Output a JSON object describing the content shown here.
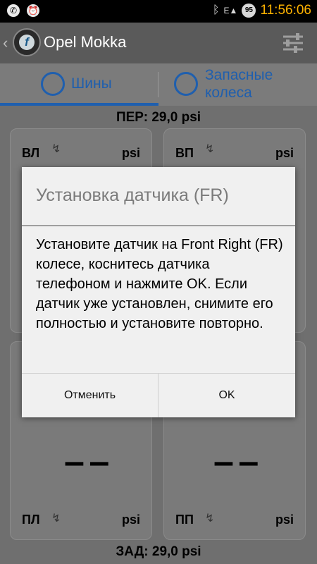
{
  "status_bar": {
    "time": "11:56:06",
    "left_icons": [
      "whatsapp-icon",
      "alarm-icon"
    ],
    "right_icons": [
      "bluetooth-icon",
      "signal-icon",
      "battery-icon"
    ],
    "edge_indicator": "E",
    "battery_level": "95"
  },
  "app_bar": {
    "title": "Opel Mokka",
    "back_icon": "chevron-left-icon",
    "menu_icon": "filter-sliders-icon"
  },
  "tabs": [
    {
      "label": "Шины",
      "icon": "car-top-icon",
      "selected": true
    },
    {
      "label": "Запасные колеса",
      "icon": "wheel-icon",
      "selected": false
    }
  ],
  "front": {
    "label": "ПЕР:",
    "value": "29,0 psi"
  },
  "rear": {
    "label": "ЗАД:",
    "value": "29,0 psi"
  },
  "tires": {
    "fl": {
      "label": "ВЛ",
      "unit": "psi",
      "value": ""
    },
    "fr": {
      "label": "ВП",
      "unit": "psi",
      "value": ""
    },
    "rl": {
      "label": "ПЛ",
      "unit": "psi",
      "value": "– –"
    },
    "rr": {
      "label": "ПП",
      "unit": "psi",
      "value": "– –"
    }
  },
  "dialog": {
    "title": "Установка датчика (FR)",
    "message": "Установите датчик на Front Right (FR) колесе, коснитесь датчика телефоном и нажмите OK. Если датчик уже установлен, снимите его полностью и установите повторно.",
    "cancel_label": "Отменить",
    "ok_label": "OK"
  },
  "colors": {
    "accent": "#1f5fae",
    "time": "#ffb300"
  }
}
